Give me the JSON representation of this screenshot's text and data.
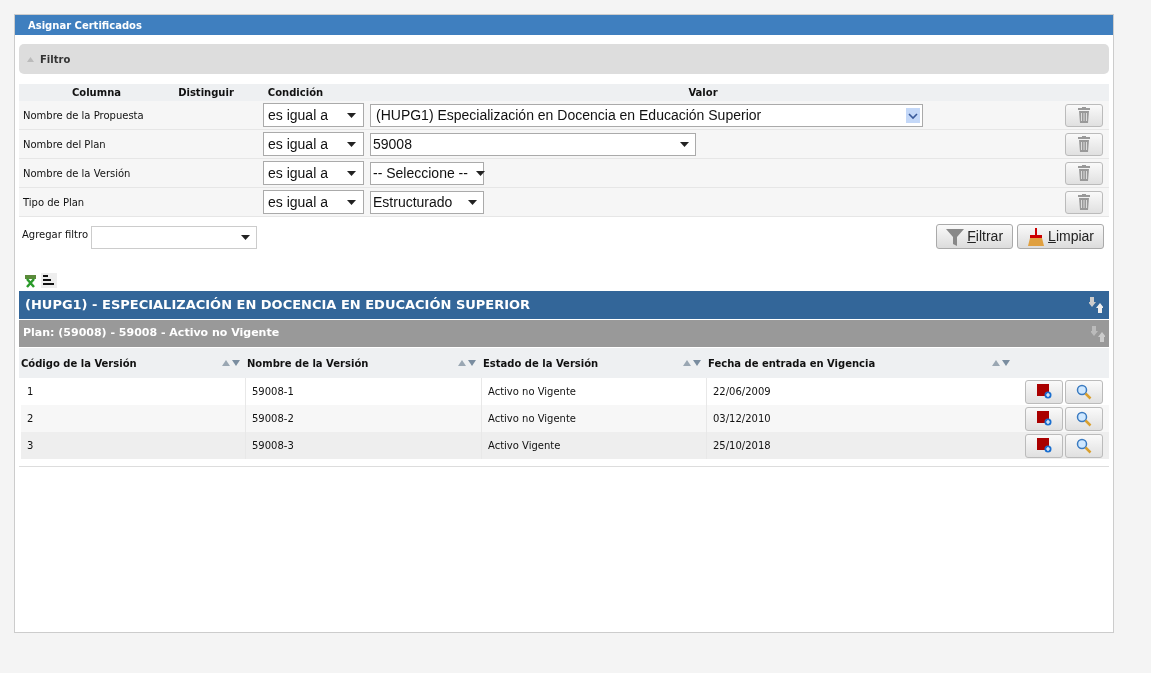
{
  "window": {
    "title": "Asignar Certificados"
  },
  "filter": {
    "title": "Filtro",
    "expanded": true,
    "columns": [
      "Columna",
      "Distinguir",
      "Condición",
      "Valor"
    ],
    "rows": [
      {
        "column": "Nombre de la Propuesta",
        "condition": "es igual a",
        "value": "(HUPG1) Especialización en Docencia en Educación Superior",
        "kind": "combo"
      },
      {
        "column": "Nombre del Plan",
        "condition": "es igual a",
        "value": "59008",
        "kind": "select-wide"
      },
      {
        "column": "Nombre de la Versión",
        "condition": "es igual a",
        "value": "-- Seleccione --",
        "kind": "select"
      },
      {
        "column": "Tipo de Plan",
        "condition": "es igual a",
        "value": "Estructurado",
        "kind": "select"
      }
    ],
    "add_filter": {
      "label": "Agregar filtro"
    },
    "buttons": [
      {
        "label": "Filtrar",
        "kind": "filter"
      },
      {
        "label": "Limpiar",
        "kind": "clear"
      }
    ]
  },
  "group": {
    "title": "(HUPG1) - ESPECIALIZACIÓN EN DOCENCIA EN EDUCACIÓN SUPERIOR",
    "plan": "Plan: (59008) - 59008 - Activo no Vigente",
    "columns": [
      "Código de la Versión",
      "Nombre de la Versión",
      "Estado de la Versión",
      "Fecha de entrada en Vigencia"
    ],
    "rows": [
      {
        "cells": [
          "1",
          "59008-1",
          "Activo no Vigente",
          "22/06/2009"
        ]
      },
      {
        "cells": [
          "2",
          "59008-2",
          "Activo no Vigente",
          "03/12/2010"
        ]
      },
      {
        "cells": [
          "3",
          "59008-3",
          "Activo Vigente",
          "25/10/2018"
        ]
      }
    ]
  }
}
